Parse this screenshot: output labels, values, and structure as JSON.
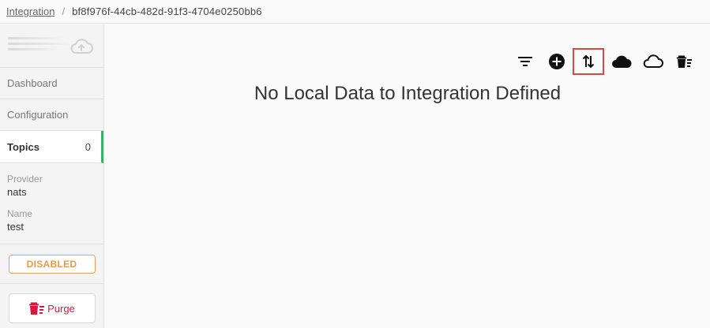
{
  "breadcrumb": {
    "root": "Integration",
    "separator": "/",
    "current": "bf8f976f-44cb-482d-91f3-4704e0250bb6"
  },
  "sidebar": {
    "upload_icon": "cloud-upload-icon",
    "nav": [
      {
        "label": "Dashboard"
      },
      {
        "label": "Configuration"
      },
      {
        "label": "Topics",
        "count": "0"
      }
    ],
    "provider_label": "Provider",
    "provider_value": "nats",
    "name_label": "Name",
    "name_value": "test",
    "status": "DISABLED",
    "purge_label": "Purge"
  },
  "toolbar": {
    "icons": [
      "filter-icon",
      "add-circle-icon",
      "sort-arrows-icon",
      "cloud-icon",
      "cloud-outline-icon",
      "delete-sweep-icon"
    ],
    "highlight_color": "#d9474a"
  },
  "main": {
    "empty_message": "No Local Data to Integration Defined"
  },
  "colors": {
    "active_accent": "#3fae6a",
    "status_orange": "#e39a4f",
    "purge_red": "#d7193f"
  }
}
